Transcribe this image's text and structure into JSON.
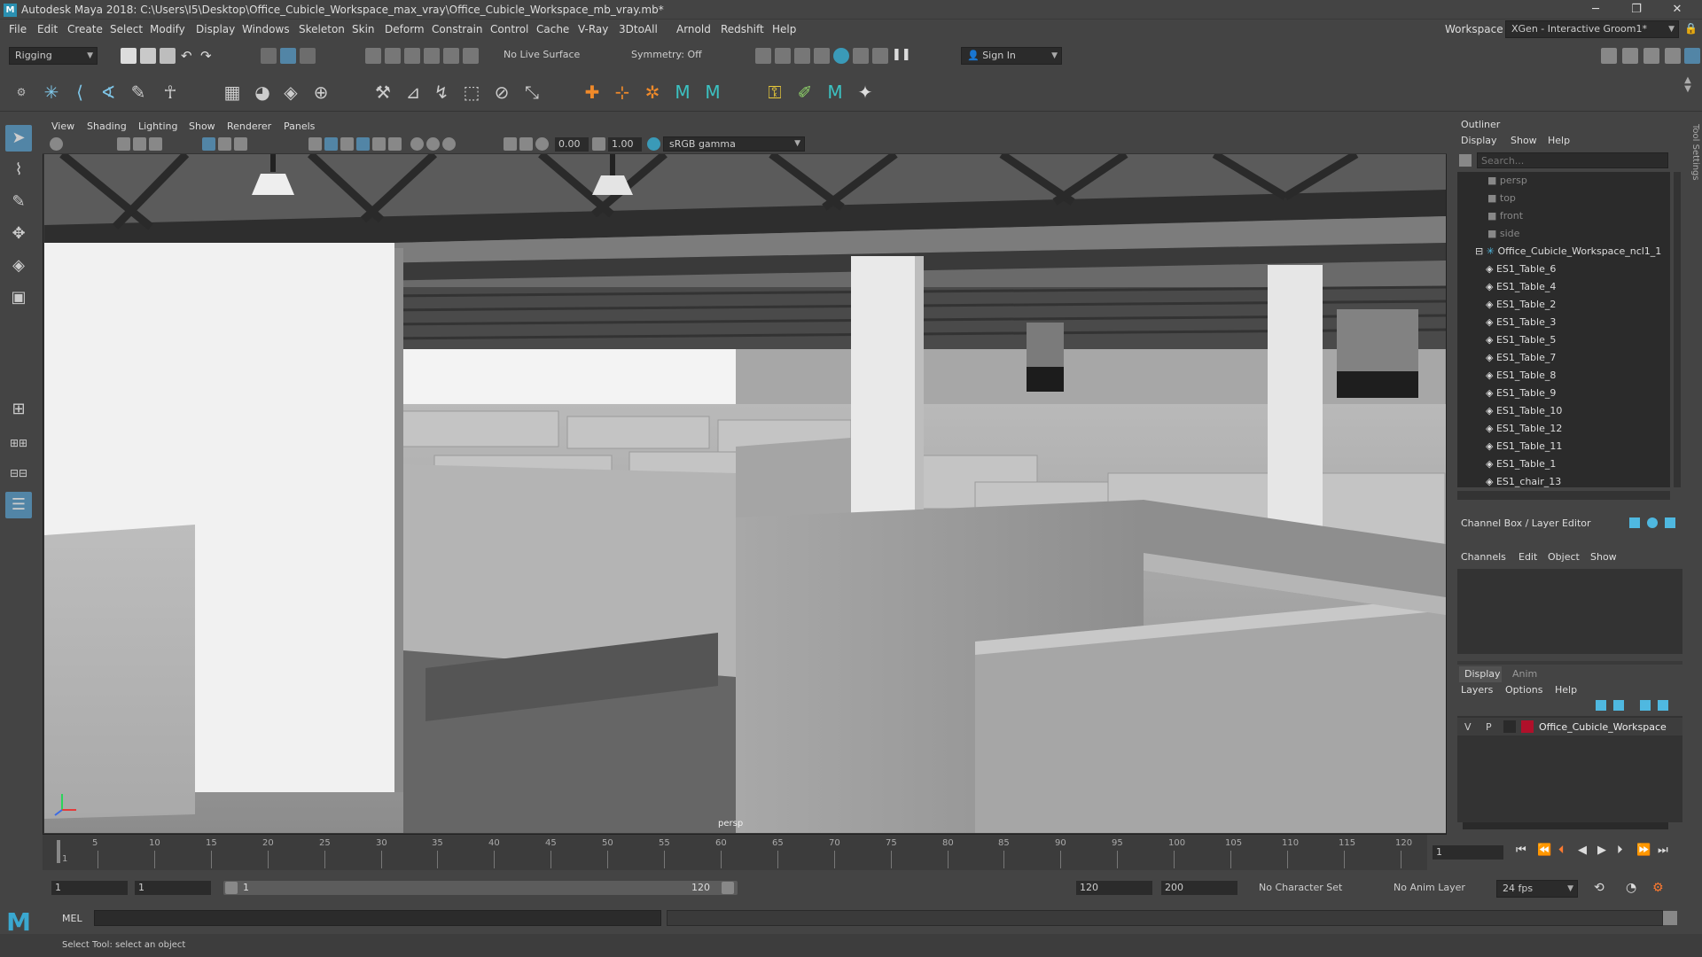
{
  "window": {
    "logo": "M",
    "title": "Autodesk Maya 2018: C:\\Users\\I5\\Desktop\\Office_Cubicle_Workspace_max_vray\\Office_Cubicle_Workspace_mb_vray.mb*",
    "minimize": "─",
    "maximize": "❐",
    "close": "✕"
  },
  "menubar": {
    "items": [
      "File",
      "Edit",
      "Create",
      "Select",
      "Modify",
      "Display",
      "Windows",
      "Skeleton",
      "Skin",
      "Deform",
      "Constrain",
      "Control",
      "Cache",
      "V-Ray",
      "3DtoAll",
      "Arnold",
      "Redshift",
      "Help"
    ],
    "workspace_label": "Workspace :",
    "workspace_value": "XGen - Interactive Groom1*"
  },
  "statusline": {
    "mode": "Rigging",
    "live_surface": "No Live Surface",
    "symmetry": "Symmetry: Off",
    "sign_in": "Sign In"
  },
  "viewport_panel": {
    "menus": [
      "View",
      "Shading",
      "Lighting",
      "Show",
      "Renderer",
      "Panels"
    ],
    "exposure": "0.00",
    "gamma": "1.00",
    "color_space": "sRGB gamma",
    "camera_label": "persp"
  },
  "outliner": {
    "title": "Outliner",
    "menus": [
      "Display",
      "Show",
      "Help"
    ],
    "search_placeholder": "Search...",
    "cameras": [
      "persp",
      "top",
      "front",
      "side"
    ],
    "group": "Office_Cubicle_Workspace_ncl1_1",
    "children": [
      "ES1_Table_6",
      "ES1_Table_4",
      "ES1_Table_2",
      "ES1_Table_3",
      "ES1_Table_5",
      "ES1_Table_7",
      "ES1_Table_8",
      "ES1_Table_9",
      "ES1_Table_10",
      "ES1_Table_12",
      "ES1_Table_11",
      "ES1_Table_1",
      "ES1_chair_13"
    ]
  },
  "channelbox": {
    "title": "Channel Box / Layer Editor",
    "menus": [
      "Channels",
      "Edit",
      "Object",
      "Show"
    ],
    "tabs": [
      "Display",
      "Anim"
    ],
    "layer_menus": [
      "Layers",
      "Options",
      "Help"
    ],
    "layer": {
      "v": "V",
      "p": "P",
      "name": "Office_Cubicle_Workspace",
      "color": "#b0102a"
    }
  },
  "timeline": {
    "ticks": [
      "5",
      "10",
      "15",
      "20",
      "25",
      "30",
      "35",
      "40",
      "45",
      "50",
      "55",
      "60",
      "65",
      "70",
      "75",
      "80",
      "85",
      "90",
      "95",
      "100",
      "105",
      "110",
      "115",
      "120"
    ],
    "start": "1",
    "current_frame": "1"
  },
  "range": {
    "start": "1",
    "playback_start": "1",
    "slider_start": "1",
    "slider_end": "120",
    "playback_end": "120",
    "end": "200",
    "character_set": "No Character Set",
    "anim_layer": "No Anim Layer",
    "fps": "24 fps"
  },
  "cmdline": {
    "label": "MEL"
  },
  "helpline": {
    "text": "Select Tool: select an object"
  },
  "side_tab": {
    "label": "Tool Settings"
  },
  "colors": {
    "accent": "#2a8fb0",
    "selected_tool": "#5285a6",
    "layer_color": "#b0102a"
  }
}
